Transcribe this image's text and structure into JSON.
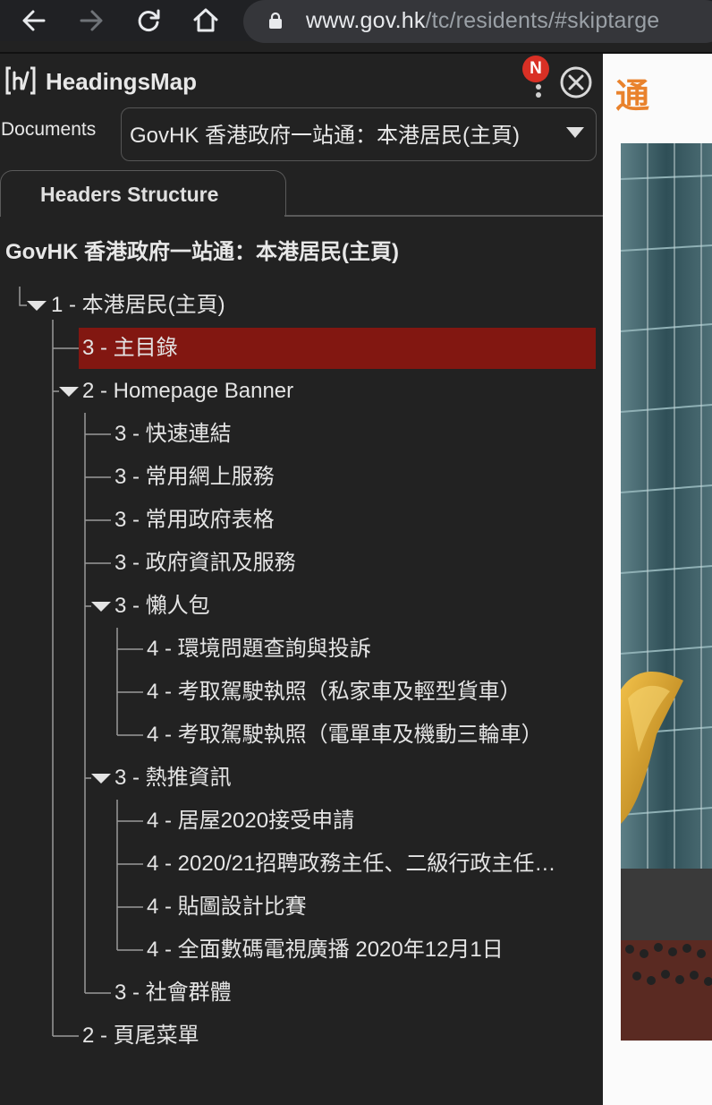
{
  "browser": {
    "url_host": "www.gov.hk",
    "url_path": "/tc/residents/#skiptarge"
  },
  "app": {
    "title": "HeadingsMap",
    "notification_badge": "N"
  },
  "documents": {
    "label": "Documents",
    "selected": "GovHK 香港政府一站通：本港居民(主頁)"
  },
  "tab": {
    "label": "Headers Structure"
  },
  "document_heading": "GovHK 香港政府一站通：本港居民(主頁)",
  "tree": [
    {
      "text": "1 - 本港居民(主頁)",
      "level": 0,
      "expanded": true
    },
    {
      "text": "3 - 主目錄",
      "level": 1,
      "selected": true
    },
    {
      "text": "2 - Homepage Banner",
      "level": 1,
      "expanded": true
    },
    {
      "text": "3 - 快速連結",
      "level": 2
    },
    {
      "text": "3 - 常用網上服務",
      "level": 2
    },
    {
      "text": "3 - 常用政府表格",
      "level": 2
    },
    {
      "text": "3 - 政府資訊及服務",
      "level": 2
    },
    {
      "text": "3 - 懶人包",
      "level": 2,
      "expanded": true
    },
    {
      "text": "4 - 環境問題查詢與投訴",
      "level": 3
    },
    {
      "text": "4 - 考取駕駛執照（私家車及輕型貨車）",
      "level": 3
    },
    {
      "text": "4 - 考取駕駛執照（電單車及機動三輪車）",
      "level": 3
    },
    {
      "text": "3 - 熱推資訊",
      "level": 2,
      "expanded": true
    },
    {
      "text": "4 - 居屋2020接受申請",
      "level": 3
    },
    {
      "text": "4 - 2020/21招聘政務主任、二級行政主任…",
      "level": 3
    },
    {
      "text": "4 - 貼圖設計比賽",
      "level": 3
    },
    {
      "text": "4 - 全面數碼電視廣播 2020年12月1日",
      "level": 3
    },
    {
      "text": "3 - 社會群體",
      "level": 2
    },
    {
      "text": "2 - 頁尾菜單",
      "level": 1
    }
  ],
  "page_preview": {
    "heading_fragment": "通"
  },
  "colors": {
    "panel_bg": "#222222",
    "selected_bg": "#821711",
    "badge_red": "#d93025",
    "accent_orange": "#e9822c"
  }
}
